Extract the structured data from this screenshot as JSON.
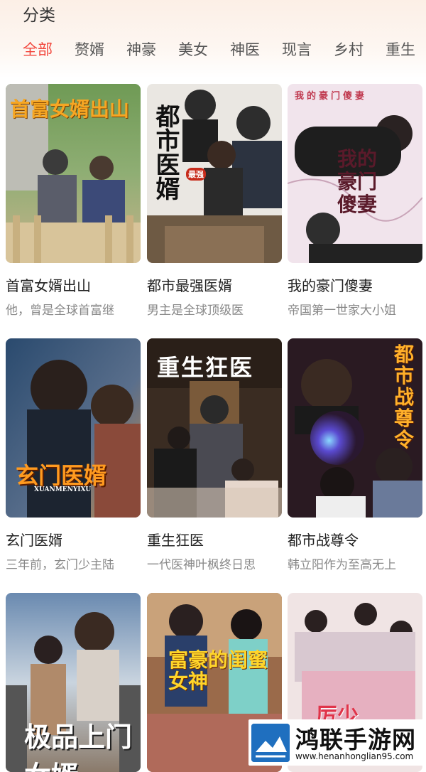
{
  "header": {
    "title": "分类",
    "tabs": [
      "全部",
      "赘婿",
      "神豪",
      "美女",
      "神医",
      "现言",
      "乡村",
      "重生"
    ]
  },
  "dramas": [
    {
      "title": "首富女婿出山",
      "desc": "他，曾是全球首富继",
      "poster_text": "首富女婿出山"
    },
    {
      "title": "都市最强医婿",
      "desc": "男主是全球顶级医",
      "poster_text": "都市医婿",
      "poster_subtext": "最强"
    },
    {
      "title": "我的豪门傻妻",
      "desc": "帝国第一世家大小姐",
      "poster_text": "我的豪门傻妻",
      "poster_header": "我的豪门傻妻"
    },
    {
      "title": "玄门医婿",
      "desc": "三年前，玄门少主陆",
      "poster_text": "玄门医婿",
      "poster_subtext": "XUANMENYIXU"
    },
    {
      "title": "重生狂医",
      "desc": "一代医神叶枫终日思",
      "poster_text": "重生狂医"
    },
    {
      "title": "都市战尊令",
      "desc": "韩立阳作为至高无上",
      "poster_text": "都市战尊令"
    },
    {
      "title": "",
      "desc": "",
      "poster_text": "极品上门女婿"
    },
    {
      "title": "",
      "desc": "",
      "poster_text": "富豪的闺蜜女神"
    },
    {
      "title": "",
      "desc": "",
      "poster_text": "厉少"
    }
  ],
  "watermark": {
    "name": "鸿联手游网",
    "url": "www.henanhonglian95.com"
  },
  "colors": {
    "accent": "#f2463c",
    "header_bg": "#fcefe6",
    "text_primary": "#222222",
    "text_secondary": "#888888"
  }
}
